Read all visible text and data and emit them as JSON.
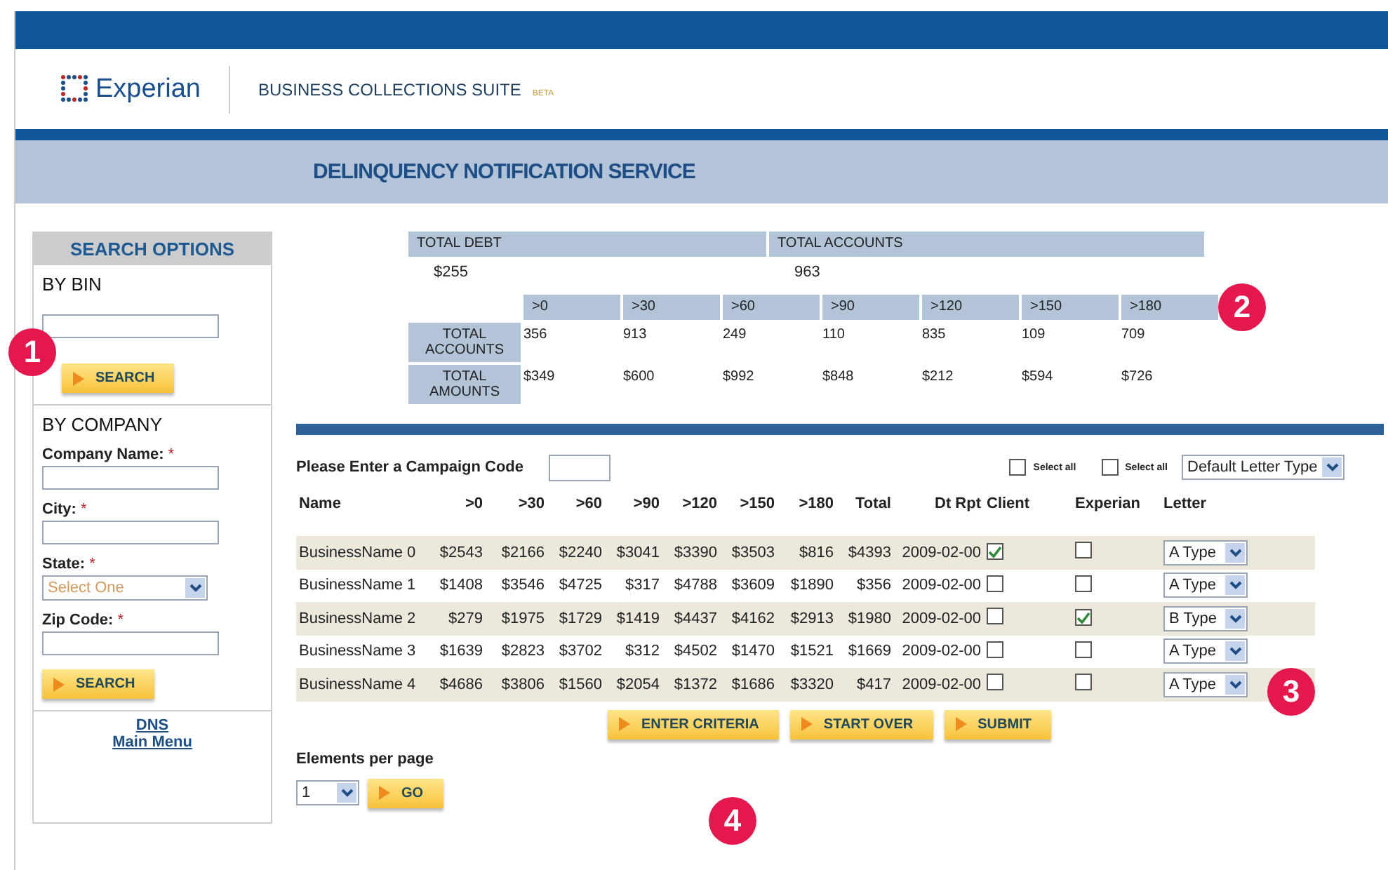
{
  "header": {
    "logo": "Experian",
    "suite": "BUSINESS COLLECTIONS SUITE",
    "badge": "BETA"
  },
  "banner": {
    "title": "DELINQUENCY NOTIFICATION SERVICE"
  },
  "sidebar": {
    "title": "SEARCH OPTIONS",
    "by_bin": {
      "heading": "BY BIN",
      "button": "SEARCH"
    },
    "by_company": {
      "heading": "BY COMPANY",
      "fields": [
        {
          "label": "Company Name:",
          "required_mark": "*",
          "kind": "text"
        },
        {
          "label": "City:",
          "required_mark": "*",
          "kind": "text"
        },
        {
          "label": "State:",
          "required_mark": "*",
          "kind": "select",
          "placeholder": "Select One"
        },
        {
          "label": "Zip Code:",
          "required_mark": "*",
          "kind": "text"
        }
      ],
      "button": "SEARCH"
    },
    "links": [
      "DNS",
      "Main Menu"
    ]
  },
  "summary": {
    "total_debt": {
      "label": "TOTAL DEBT",
      "value": "$255"
    },
    "total_accounts": {
      "label": "TOTAL ACCOUNTS",
      "value": "963"
    },
    "buckets": [
      ">0",
      ">30",
      ">60",
      ">90",
      ">120",
      ">150",
      ">180"
    ],
    "rows": [
      {
        "label": "TOTAL ACCOUNTS",
        "values": [
          "356",
          "913",
          "249",
          "110",
          "835",
          "109",
          "709"
        ]
      },
      {
        "label": "TOTAL AMOUNTS",
        "values": [
          "$349",
          "$600",
          "$992",
          "$848",
          "$212",
          "$594",
          "$726"
        ]
      }
    ]
  },
  "campaign": {
    "label": "Please Enter a Campaign Code",
    "select_all": [
      {
        "label": "Select all",
        "checked": false
      },
      {
        "label": "Select all",
        "checked": false
      }
    ],
    "default_letter": "Default Letter Type"
  },
  "table": {
    "columns": [
      "Name",
      ">0",
      ">30",
      ">60",
      ">90",
      ">120",
      ">150",
      ">180",
      "Total",
      "Dt Rpt",
      "Client",
      "Experian",
      "Letter"
    ],
    "rows": [
      {
        "cells": [
          "BusinessName 0",
          "$2543",
          "$2166",
          "$2240",
          "$3041",
          "$3390",
          "$3503",
          "$816",
          "$4393",
          "2009-02-00"
        ],
        "client": true,
        "experian": false,
        "letter": "A Type"
      },
      {
        "cells": [
          "BusinessName 1",
          "$1408",
          "$3546",
          "$4725",
          "$317",
          "$4788",
          "$3609",
          "$1890",
          "$356",
          "2009-02-00"
        ],
        "client": false,
        "experian": false,
        "letter": "A Type"
      },
      {
        "cells": [
          "BusinessName 2",
          "$279",
          "$1975",
          "$1729",
          "$1419",
          "$4437",
          "$4162",
          "$2913",
          "$1980",
          "2009-02-00"
        ],
        "client": false,
        "experian": true,
        "letter": "B Type"
      },
      {
        "cells": [
          "BusinessName 3",
          "$1639",
          "$2823",
          "$3702",
          "$312",
          "$4502",
          "$1470",
          "$1521",
          "$1669",
          "2009-02-00"
        ],
        "client": false,
        "experian": false,
        "letter": "A Type"
      },
      {
        "cells": [
          "BusinessName 4",
          "$4686",
          "$3806",
          "$1560",
          "$2054",
          "$1372",
          "$1686",
          "$3320",
          "$417",
          "2009-02-00"
        ],
        "client": false,
        "experian": false,
        "letter": "A Type"
      }
    ]
  },
  "actions": [
    "ENTER CRITERIA",
    "START OVER",
    "SUBMIT"
  ],
  "paging": {
    "label": "Elements per page",
    "value": "1",
    "button": "GO"
  },
  "callouts": [
    "1",
    "2",
    "3",
    "4"
  ]
}
